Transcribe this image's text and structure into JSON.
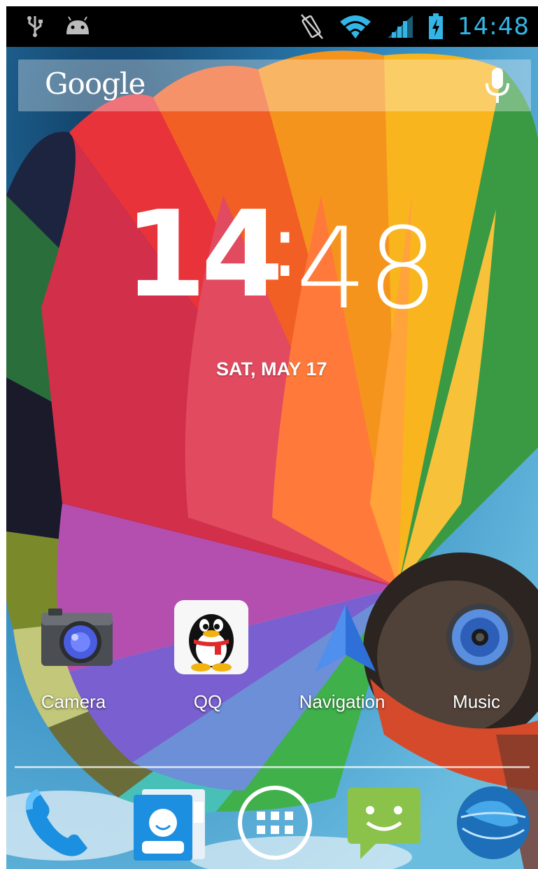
{
  "status_bar": {
    "time": "14:48",
    "left_icons": [
      "usb-icon",
      "android-debug-icon"
    ],
    "right_icons": [
      "vibrate-icon",
      "wifi-icon",
      "signal-icon",
      "battery-charging-icon"
    ],
    "accent_color": "#33b5e5"
  },
  "search": {
    "logo_text": "Google",
    "mic_icon": "microphone-icon"
  },
  "clock": {
    "hours": "14",
    "separator": ":",
    "minutes": "48",
    "date": "SAT, MAY 17"
  },
  "apps": [
    {
      "label": "Camera",
      "icon": "camera-icon"
    },
    {
      "label": "QQ",
      "icon": "qq-penguin-icon"
    },
    {
      "label": "Navigation",
      "icon": "navigation-arrow-icon"
    },
    {
      "label": "Music",
      "icon": "speaker-icon"
    }
  ],
  "dock": [
    {
      "icon": "phone-icon"
    },
    {
      "icon": "contacts-icon"
    },
    {
      "icon": "app-drawer-icon"
    },
    {
      "icon": "messaging-icon"
    },
    {
      "icon": "browser-globe-icon"
    }
  ]
}
